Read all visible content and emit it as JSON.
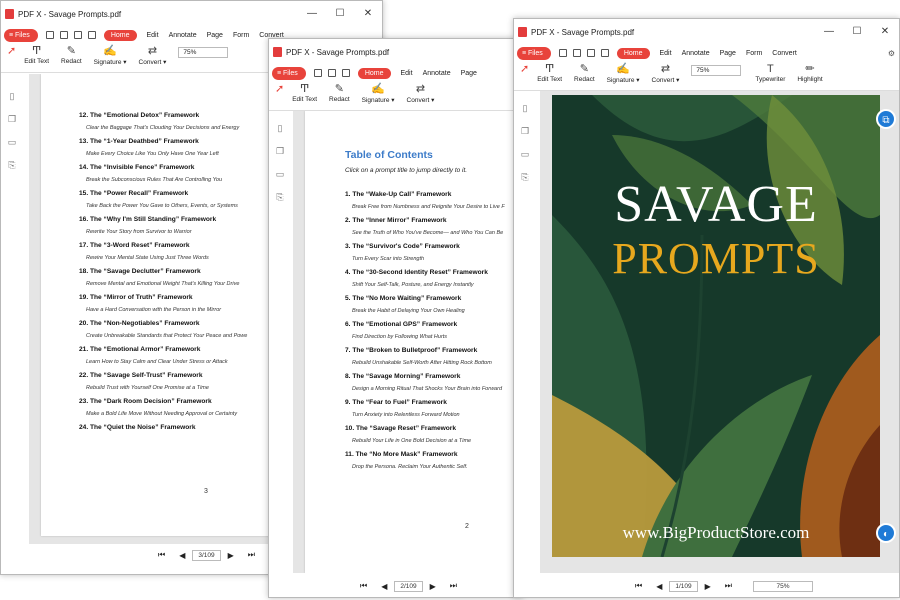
{
  "window_title": "PDF X - Savage Prompts.pdf",
  "menu": {
    "files": "Files",
    "tabs": [
      "Home",
      "Edit",
      "Annotate",
      "Page",
      "Form",
      "Convert"
    ]
  },
  "tools": {
    "edit_text": "Edit Text",
    "redact": "Redact",
    "signature": "Signature ▾",
    "convert": "Convert ▾",
    "typewriter": "Typewriter",
    "highlight": "Highlight"
  },
  "zoom": "75%",
  "win1": {
    "page_label": "3",
    "page_indicator": "3/109",
    "entries": [
      {
        "title": "12. The “Emotional Detox” Framework",
        "sub": "Clear the Baggage That's Clouding Your Decisions and Energy"
      },
      {
        "title": "13. The “1-Year Deathbed” Framework",
        "sub": "Make Every Choice Like You Only Have One Year Left"
      },
      {
        "title": "14. The “Invisible Fence” Framework",
        "sub": "Break the Subconscious Rules That Are Controlling You"
      },
      {
        "title": "15. The “Power Recall” Framework",
        "sub": "Take Back the Power You Gave to Others, Events, or Systems"
      },
      {
        "title": "16. The “Why I'm Still Standing” Framework",
        "sub": "Rewrite Your Story from Survivor to Warrior"
      },
      {
        "title": "17. The “3-Word Reset” Framework",
        "sub": "Rewire Your Mental State Using Just Three Words"
      },
      {
        "title": "18. The “Savage Declutter” Framework",
        "sub": "Remove Mental and Emotional Weight That's Killing Your Drive"
      },
      {
        "title": "19. The “Mirror of Truth” Framework",
        "sub": "Have a Hard Conversation with the Person in the Mirror"
      },
      {
        "title": "20. The “Non-Negotiables” Framework",
        "sub": "Create Unbreakable Standards that Protect Your Peace and Powe"
      },
      {
        "title": "21. The “Emotional Armor” Framework",
        "sub": "Learn How to Stay Calm and Clear Under Stress or Attack"
      },
      {
        "title": "22. The “Savage Self-Trust” Framework",
        "sub": "Rebuild Trust with Yourself One Promise at a Time"
      },
      {
        "title": "23. The “Dark Room Decision” Framework",
        "sub": "Make a Bold Life Move Without Needing Approval or Certainty"
      },
      {
        "title": "24. The “Quiet the Noise” Framework",
        "sub": ""
      }
    ]
  },
  "win2": {
    "toc_title": "Table of Contents",
    "toc_intro": "Click on a prompt title to jump directly to it.",
    "page_label": "2",
    "page_indicator": "2/109",
    "entries": [
      {
        "title": "1. The “Wake-Up Call” Framework",
        "sub": "Break Free from Numbness and Reignite Your Desire to Live F"
      },
      {
        "title": "2. The “Inner Mirror” Framework",
        "sub": "See the Truth of Who You've Become— and Who You Can Be"
      },
      {
        "title": "3. The “Survivor's Code” Framework",
        "sub": "Turn Every Scar into Strength"
      },
      {
        "title": "4. The “30-Second Identity Reset” Framework",
        "sub": "Shift Your Self-Talk, Posture, and Energy Instantly"
      },
      {
        "title": "5. The “No More Waiting” Framework",
        "sub": "Break the Habit of Delaying Your Own Healing"
      },
      {
        "title": "6. The “Emotional GPS” Framework",
        "sub": "Find Direction by Following What Hurts"
      },
      {
        "title": "7. The “Broken to Bulletproof” Framework",
        "sub": "Rebuild Unshakable Self-Worth After Hitting Rock Bottom"
      },
      {
        "title": "8. The “Savage Morning” Framework",
        "sub": "Design a Morning Ritual That Shocks Your Brain into Forward"
      },
      {
        "title": "9. The “Fear to Fuel” Framework",
        "sub": "Turn Anxiety into Relentless Forward Motion"
      },
      {
        "title": "10. The “Savage Reset” Framework",
        "sub": "Rebuild Your Life in One Bold Decision at a Time"
      },
      {
        "title": "11. The “No More Mask” Framework",
        "sub": "Drop the Persona. Reclaim Your Authentic Self."
      }
    ]
  },
  "win3": {
    "cover_title_1": "SAVAGE",
    "cover_title_2": "PROMPTS",
    "cover_url": "www.BigProductStore.com",
    "page_indicator": "1/109"
  },
  "colors": {
    "accent": "#e8433b",
    "toc_blue": "#3d7cc9",
    "cover_gold": "#e7a81e",
    "cover_green": "#143a2a"
  }
}
